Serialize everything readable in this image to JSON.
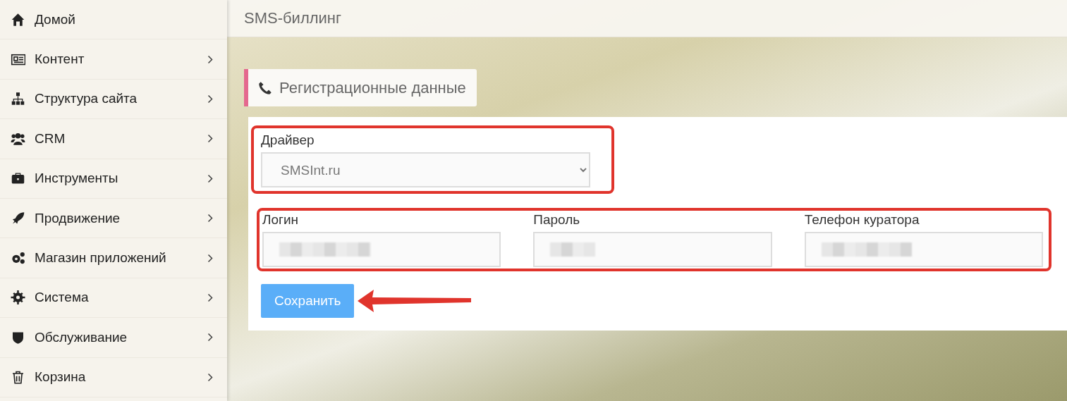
{
  "sidebar": {
    "items": [
      {
        "label": "Домой",
        "expandable": false
      },
      {
        "label": "Контент",
        "expandable": true
      },
      {
        "label": "Структура сайта",
        "expandable": true
      },
      {
        "label": "CRM",
        "expandable": true
      },
      {
        "label": "Инструменты",
        "expandable": true
      },
      {
        "label": "Продвижение",
        "expandable": true
      },
      {
        "label": "Магазин приложений",
        "expandable": true
      },
      {
        "label": "Система",
        "expandable": true
      },
      {
        "label": "Обслуживание",
        "expandable": true
      },
      {
        "label": "Корзина",
        "expandable": true
      }
    ]
  },
  "header": {
    "title": "SMS-биллинг"
  },
  "panel": {
    "tab": "Регистрационные данные",
    "driver": {
      "label": "Драйвер",
      "value": "SMSInt.ru"
    },
    "fields": [
      {
        "label": "Логин",
        "redacted": true
      },
      {
        "label": "Пароль",
        "redacted": true
      },
      {
        "label": "Телефон куратора",
        "redacted": true
      }
    ],
    "save_button": "Сохранить"
  }
}
